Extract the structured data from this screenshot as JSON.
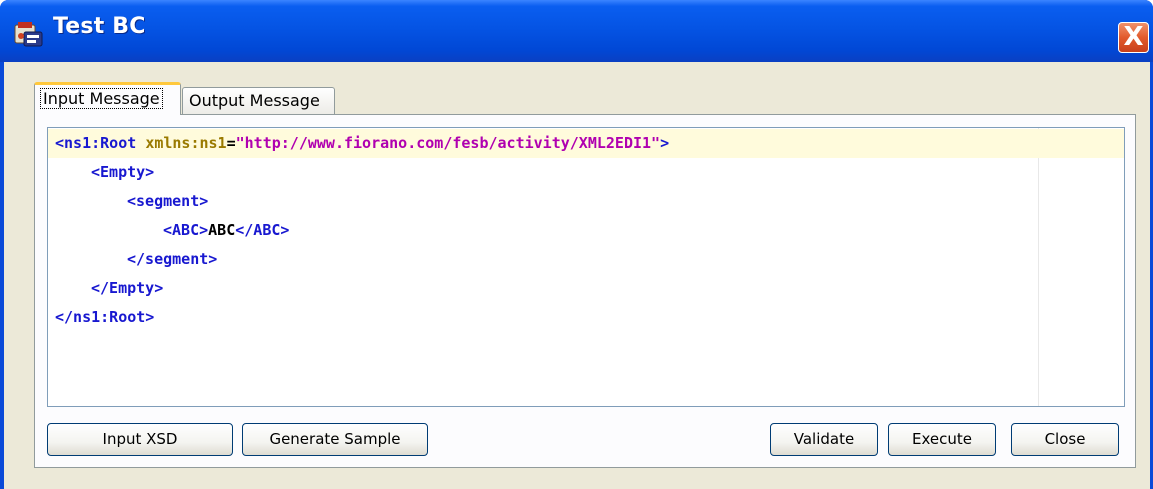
{
  "window": {
    "title": "Test BC",
    "close_label": "X"
  },
  "tabs": [
    {
      "label": "Input Message",
      "active": true
    },
    {
      "label": "Output Message",
      "active": false
    }
  ],
  "editor": {
    "lines": [
      {
        "indent": 0,
        "parts": [
          {
            "kind": "tag",
            "text": "<ns1:Root "
          },
          {
            "kind": "attr",
            "text": "xmlns:ns1"
          },
          {
            "kind": "eq",
            "text": "="
          },
          {
            "kind": "val",
            "text": "\"http://www.fiorano.com/fesb/activity/XML2EDI1\""
          },
          {
            "kind": "tag",
            "text": ">"
          }
        ]
      },
      {
        "indent": 1,
        "parts": [
          {
            "kind": "tag",
            "text": "<Empty>"
          }
        ]
      },
      {
        "indent": 2,
        "parts": [
          {
            "kind": "tag",
            "text": "<segment>"
          }
        ]
      },
      {
        "indent": 3,
        "parts": [
          {
            "kind": "tag",
            "text": "<ABC>"
          },
          {
            "kind": "txt",
            "text": "ABC"
          },
          {
            "kind": "tag",
            "text": "</ABC>"
          }
        ]
      },
      {
        "indent": 2,
        "parts": [
          {
            "kind": "tag",
            "text": "</segment>"
          }
        ]
      },
      {
        "indent": 1,
        "parts": [
          {
            "kind": "tag",
            "text": "</Empty>"
          }
        ]
      },
      {
        "indent": 0,
        "parts": [
          {
            "kind": "tag",
            "text": "</ns1:Root>"
          }
        ]
      }
    ]
  },
  "buttons": {
    "input_xsd": "Input XSD",
    "generate_sample": "Generate Sample",
    "validate": "Validate",
    "execute": "Execute",
    "close": "Close"
  },
  "colors": {
    "titlebar": "#0554e4",
    "client_bg": "#ece9d8",
    "tag": "#1818d0",
    "attribute": "#9a7a00",
    "value": "#b000b0",
    "highlight_line": "#fffbdc"
  },
  "icons": {
    "app_icon": "test-bc-app-icon",
    "close_icon": "close-icon"
  }
}
